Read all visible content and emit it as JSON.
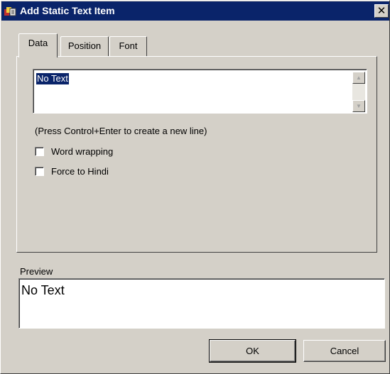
{
  "window": {
    "title": "Add Static Text Item",
    "close_label": "✕"
  },
  "tabs": [
    {
      "label": "Data",
      "active": true
    },
    {
      "label": "Position",
      "active": false
    },
    {
      "label": "Font",
      "active": false
    }
  ],
  "data_tab": {
    "text_value": "No Text",
    "hint": "(Press Control+Enter to create a new line)",
    "checkboxes": [
      {
        "label": "Word wrapping",
        "checked": false
      },
      {
        "label": "Force to Hindi",
        "checked": false
      }
    ]
  },
  "preview": {
    "label": "Preview",
    "text": "No Text"
  },
  "buttons": {
    "ok": "OK",
    "cancel": "Cancel"
  },
  "colors": {
    "titlebar": "#0a246a",
    "face": "#d4d0c8",
    "selection": "#0a246a"
  }
}
